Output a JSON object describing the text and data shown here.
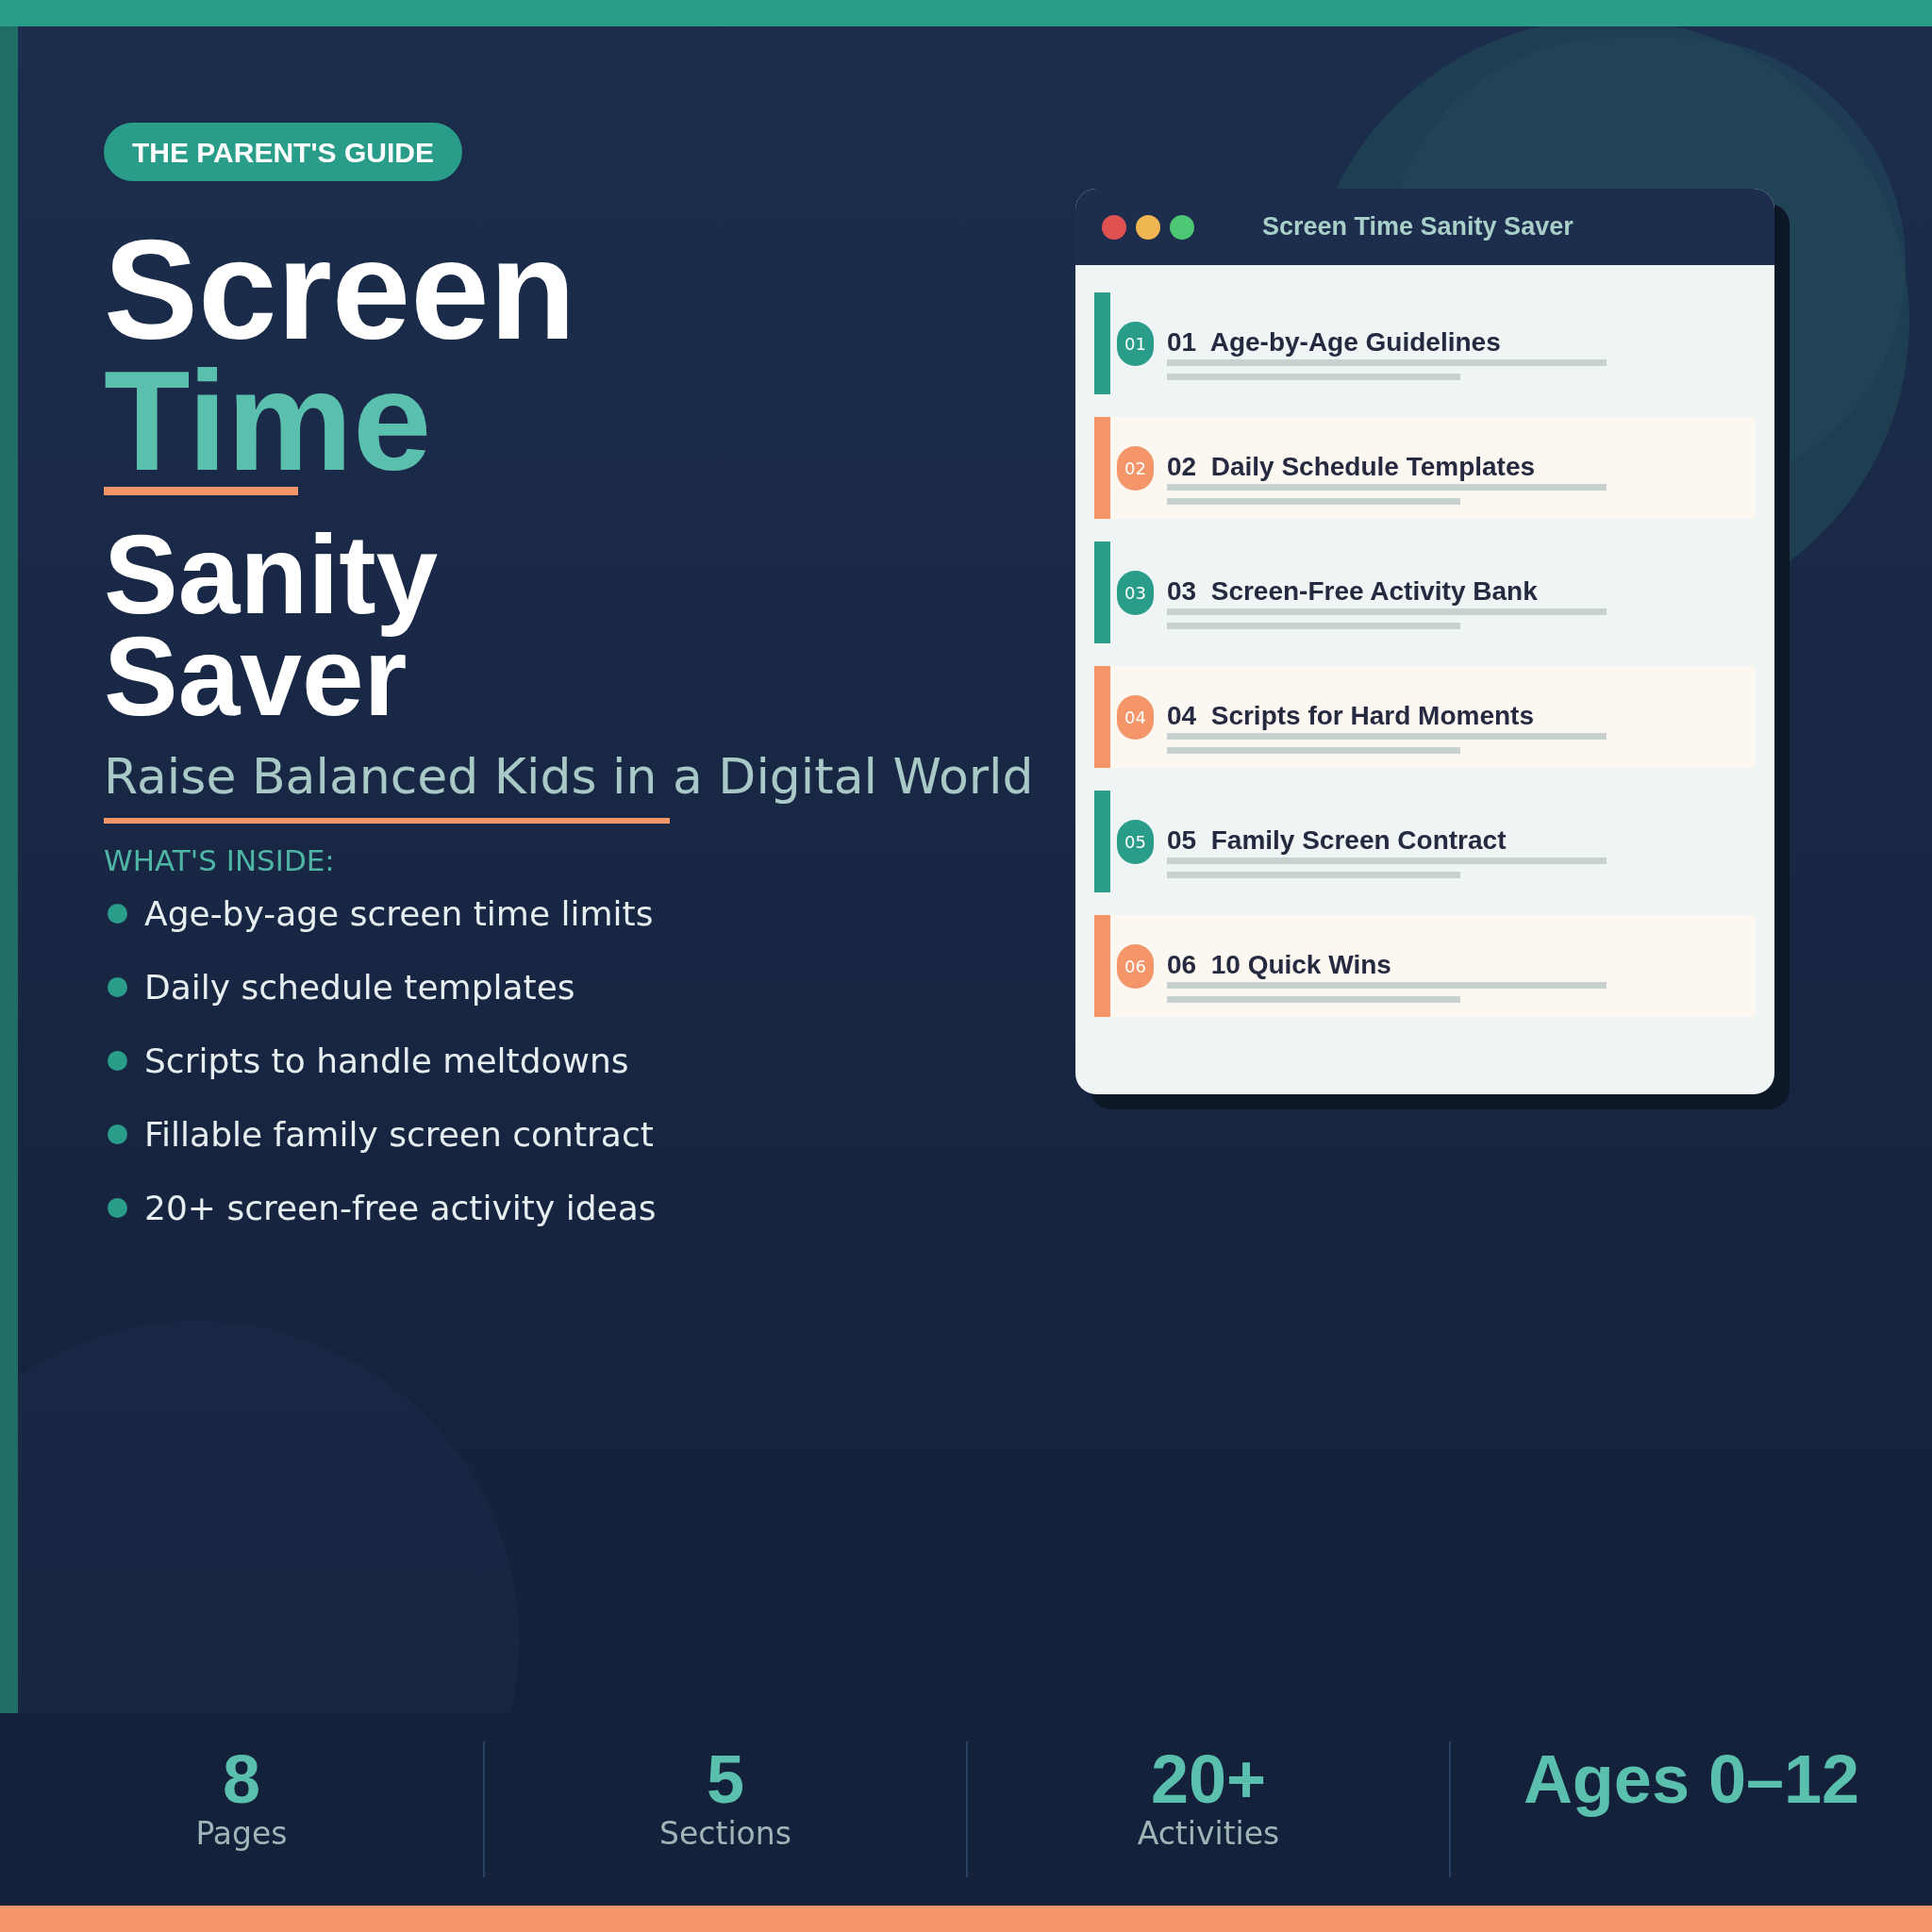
{
  "badge": "THE PARENT'S GUIDE",
  "title": {
    "line_1": "Screen",
    "line_2": "Time",
    "line_3": "Sanity",
    "line_4": "Saver"
  },
  "subtitle": "Raise Balanced Kids in a Digital World",
  "inside": {
    "heading": "WHAT'S INSIDE:",
    "items": [
      "Age-by-age screen time limits",
      "Daily schedule templates",
      "Scripts to handle meltdowns",
      "Fillable family screen contract",
      "20+ screen-free activity ideas"
    ]
  },
  "window": {
    "title": "Screen Time Sanity Saver",
    "sections": [
      {
        "number": "01",
        "title": "01  Age-by-Age Guidelines",
        "color": "#2a9d8a"
      },
      {
        "number": "02",
        "title": "02  Daily Schedule Templates",
        "color": "#f4956a"
      },
      {
        "number": "03",
        "title": "03  Screen-Free Activity Bank",
        "color": "#2a9d8a"
      },
      {
        "number": "04",
        "title": "04  Scripts for Hard Moments",
        "color": "#f4956a"
      },
      {
        "number": "05",
        "title": "05  Family Screen Contract",
        "color": "#2a9d8a"
      },
      {
        "number": "06",
        "title": "06  10 Quick Wins",
        "color": "#f4956a"
      }
    ]
  },
  "stats": [
    {
      "value": "8",
      "label": "Pages"
    },
    {
      "value": "5",
      "label": "Sections"
    },
    {
      "value": "20+",
      "label": "Activities"
    },
    {
      "value": "Ages 0–12"
    }
  ]
}
